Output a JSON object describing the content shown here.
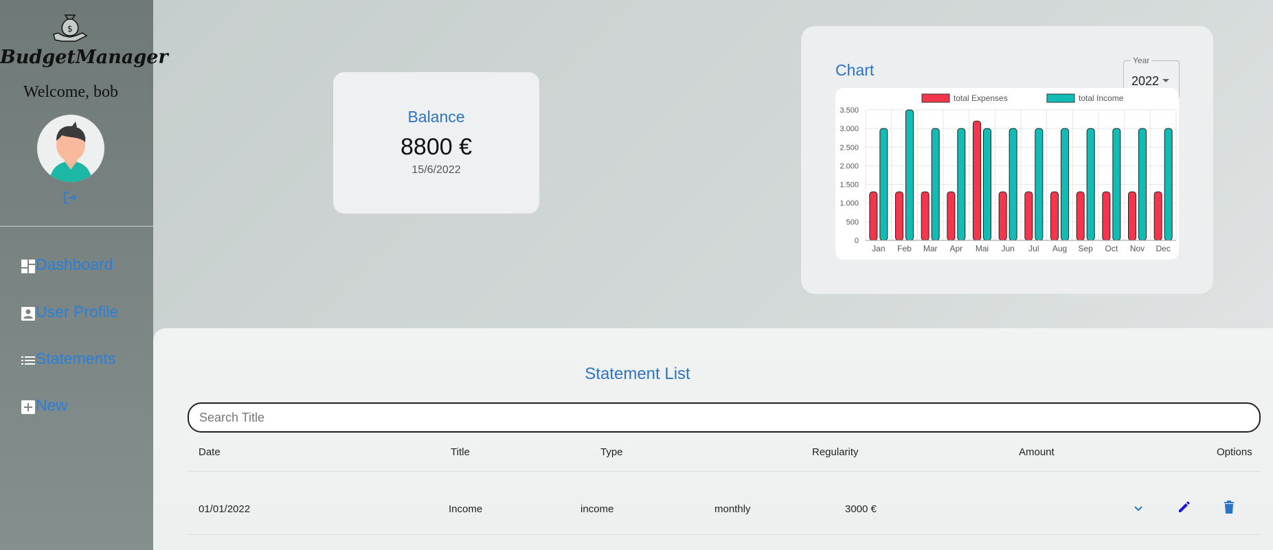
{
  "sidebar": {
    "brand": "BudgetManager",
    "welcome": "Welcome, bob",
    "nav": [
      {
        "label": "Dashboard",
        "icon": "dashboard-icon"
      },
      {
        "label": "User Profile",
        "icon": "account-box-icon"
      },
      {
        "label": "Statements",
        "icon": "list-icon"
      },
      {
        "label": "New",
        "icon": "add-box-icon"
      }
    ]
  },
  "balance": {
    "title": "Balance",
    "amount": "8800 €",
    "date": "15/6/2022"
  },
  "chart": {
    "title": "Chart",
    "year_label": "Year",
    "year_value": "2022"
  },
  "chart_data": {
    "type": "bar",
    "categories": [
      "Jan",
      "Feb",
      "Mar",
      "Apr",
      "Mai",
      "Jun",
      "Jul",
      "Aug",
      "Sep",
      "Oct",
      "Nov",
      "Dec"
    ],
    "series": [
      {
        "name": "total Expenses",
        "color": "#f4364c",
        "values": [
          1300,
          1300,
          1300,
          1300,
          3200,
          1300,
          1300,
          1300,
          1300,
          1300,
          1300,
          1300
        ]
      },
      {
        "name": "total Income",
        "color": "#12bcb5",
        "values": [
          3000,
          3500,
          3000,
          3000,
          3000,
          3000,
          3000,
          3000,
          3000,
          3000,
          3000,
          3000
        ]
      }
    ],
    "ylim": [
      0,
      3500
    ],
    "yticks": [
      "3.500",
      "3.000",
      "2.500",
      "2.000",
      "1.500",
      "1.000",
      "500",
      "0"
    ],
    "legend": "top",
    "grid": true
  },
  "statements": {
    "title": "Statement List",
    "search_placeholder": "Search Title",
    "columns": {
      "date": "Date",
      "title": "Title",
      "type": "Type",
      "regularity": "Regularity",
      "amount": "Amount",
      "options": "Options"
    },
    "rows": [
      {
        "date": "01/01/2022",
        "title": "Income",
        "type": "income",
        "regularity": "monthly",
        "amount": "3000 €"
      }
    ]
  },
  "colors": {
    "accent": "#2b74c5",
    "expenses": "#f4364c",
    "income": "#12bcb5",
    "edit_icon": "#1a1ad6"
  }
}
